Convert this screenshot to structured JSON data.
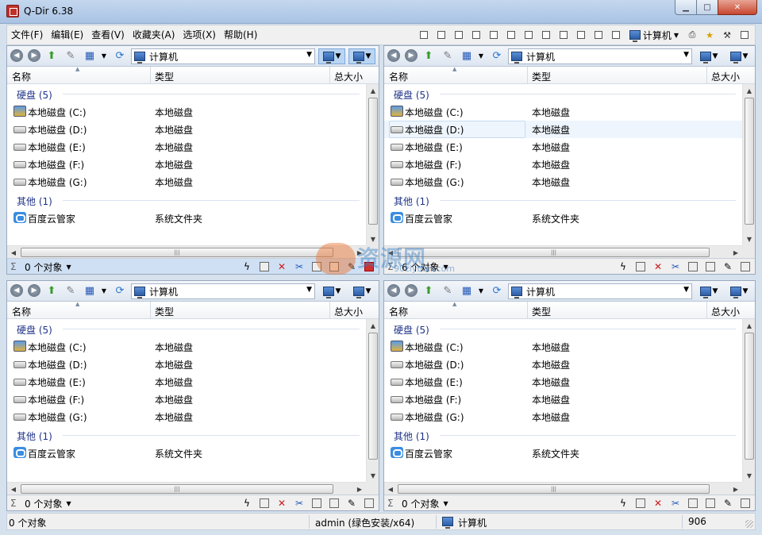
{
  "window": {
    "title": "Q-Dir 6.38",
    "minimize": "▁",
    "maximize": "□",
    "close": "✕"
  },
  "menu": {
    "items": [
      "文件(F)",
      "编辑(E)",
      "查看(V)",
      "收藏夹(A)",
      "选项(X)",
      "帮助(H)"
    ],
    "computer_label": "计算机"
  },
  "columns": {
    "name": "名称",
    "type": "类型",
    "size": "总大小"
  },
  "panes": [
    {
      "address": "计算机",
      "groups": [
        {
          "label": "硬盘 (5)",
          "items": [
            {
              "name": "本地磁盘 (C:)",
              "type": "本地磁盘",
              "icon": "system-drive-icon"
            },
            {
              "name": "本地磁盘 (D:)",
              "type": "本地磁盘",
              "icon": "drive-icon"
            },
            {
              "name": "本地磁盘 (E:)",
              "type": "本地磁盘",
              "icon": "drive-icon"
            },
            {
              "name": "本地磁盘 (F:)",
              "type": "本地磁盘",
              "icon": "drive-icon"
            },
            {
              "name": "本地磁盘 (G:)",
              "type": "本地磁盘",
              "icon": "drive-icon"
            }
          ]
        },
        {
          "label": "其他 (1)",
          "items": [
            {
              "name": "百度云管家",
              "type": "系统文件夹",
              "icon": "cloud-icon"
            }
          ]
        }
      ],
      "status": "0 个对象",
      "active": true
    },
    {
      "address": "计算机",
      "groups": [
        {
          "label": "硬盘 (5)",
          "items": [
            {
              "name": "本地磁盘 (C:)",
              "type": "本地磁盘",
              "icon": "system-drive-icon"
            },
            {
              "name": "本地磁盘 (D:)",
              "type": "本地磁盘",
              "icon": "drive-icon",
              "selected": true
            },
            {
              "name": "本地磁盘 (E:)",
              "type": "本地磁盘",
              "icon": "drive-icon"
            },
            {
              "name": "本地磁盘 (F:)",
              "type": "本地磁盘",
              "icon": "drive-icon"
            },
            {
              "name": "本地磁盘 (G:)",
              "type": "本地磁盘",
              "icon": "drive-icon"
            }
          ]
        },
        {
          "label": "其他 (1)",
          "items": [
            {
              "name": "百度云管家",
              "type": "系统文件夹",
              "icon": "cloud-icon"
            }
          ]
        }
      ],
      "status": "6 个对象",
      "active": false
    },
    {
      "address": "计算机",
      "groups": [
        {
          "label": "硬盘 (5)",
          "items": [
            {
              "name": "本地磁盘 (C:)",
              "type": "本地磁盘",
              "icon": "system-drive-icon"
            },
            {
              "name": "本地磁盘 (D:)",
              "type": "本地磁盘",
              "icon": "drive-icon"
            },
            {
              "name": "本地磁盘 (E:)",
              "type": "本地磁盘",
              "icon": "drive-icon"
            },
            {
              "name": "本地磁盘 (F:)",
              "type": "本地磁盘",
              "icon": "drive-icon"
            },
            {
              "name": "本地磁盘 (G:)",
              "type": "本地磁盘",
              "icon": "drive-icon"
            }
          ]
        },
        {
          "label": "其他 (1)",
          "items": [
            {
              "name": "百度云管家",
              "type": "系统文件夹",
              "icon": "cloud-icon"
            }
          ]
        }
      ],
      "status": "0 个对象",
      "active": false
    },
    {
      "address": "计算机",
      "groups": [
        {
          "label": "硬盘 (5)",
          "items": [
            {
              "name": "本地磁盘 (C:)",
              "type": "本地磁盘",
              "icon": "system-drive-icon"
            },
            {
              "name": "本地磁盘 (D:)",
              "type": "本地磁盘",
              "icon": "drive-icon"
            },
            {
              "name": "本地磁盘 (E:)",
              "type": "本地磁盘",
              "icon": "drive-icon"
            },
            {
              "name": "本地磁盘 (F:)",
              "type": "本地磁盘",
              "icon": "drive-icon"
            },
            {
              "name": "本地磁盘 (G:)",
              "type": "本地磁盘",
              "icon": "drive-icon"
            }
          ]
        },
        {
          "label": "其他 (1)",
          "items": [
            {
              "name": "百度云管家",
              "type": "系统文件夹",
              "icon": "cloud-icon"
            }
          ]
        }
      ],
      "status": "0 个对象",
      "active": false
    }
  ],
  "statusbar": {
    "objects": "0 个对象",
    "user": "admin (绿色安装/x64)",
    "location": "计算机",
    "number": "906"
  },
  "watermark": {
    "main": "资源网",
    "sub": "90ziyuan.com"
  }
}
